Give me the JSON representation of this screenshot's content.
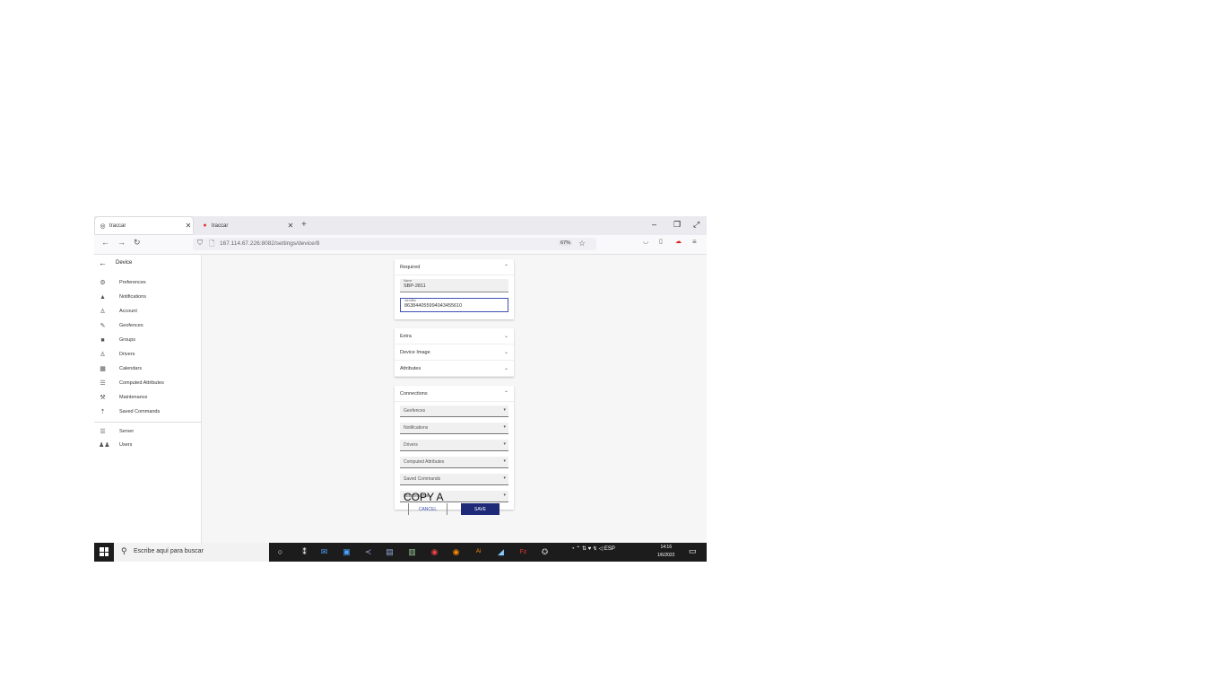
{
  "browser": {
    "tabs": [
      {
        "title": "traccar",
        "active": true
      },
      {
        "title": "traccar",
        "active": false
      }
    ],
    "new_tab": "+",
    "url": "167.114.67.226:8082/settings/device/8",
    "zoom": "67%"
  },
  "sidebar": {
    "title": "Device",
    "items": [
      {
        "label": "Preferences",
        "icon": "gear-icon"
      },
      {
        "label": "Notifications",
        "icon": "bell-icon"
      },
      {
        "label": "Account",
        "icon": "person-icon"
      },
      {
        "label": "Geofences",
        "icon": "pencil-icon"
      },
      {
        "label": "Groups",
        "icon": "folder-icon"
      },
      {
        "label": "Drivers",
        "icon": "person-icon"
      },
      {
        "label": "Calendars",
        "icon": "calendar-icon"
      },
      {
        "label": "Computed Attributes",
        "icon": "list-icon"
      },
      {
        "label": "Maintenance",
        "icon": "wrench-icon"
      },
      {
        "label": "Saved Commands",
        "icon": "publish-icon"
      }
    ],
    "admin_items": [
      {
        "label": "Server",
        "icon": "list-icon"
      },
      {
        "label": "Users",
        "icon": "people-icon"
      }
    ]
  },
  "form": {
    "required": {
      "header": "Required",
      "name_label": "Name",
      "name_value": "SBP-2811",
      "identifier_label": "Identifier",
      "identifier_value": "863844055994043455610"
    },
    "sections": [
      "Extra",
      "Device Image",
      "Attributes"
    ],
    "connections": {
      "header": "Connections",
      "selects": [
        "Geofences",
        "Notifications",
        "Drivers",
        "Computed Attributes",
        "Saved Commands",
        "Maintenance"
      ]
    },
    "overlay_text": "COPY A",
    "cancel_label": "CANCEL",
    "save_label": "SAVE"
  },
  "taskbar": {
    "search_placeholder": "Escribe aquí para buscar",
    "language": "ESP",
    "time": "14:16",
    "date": "1/6/2022"
  }
}
